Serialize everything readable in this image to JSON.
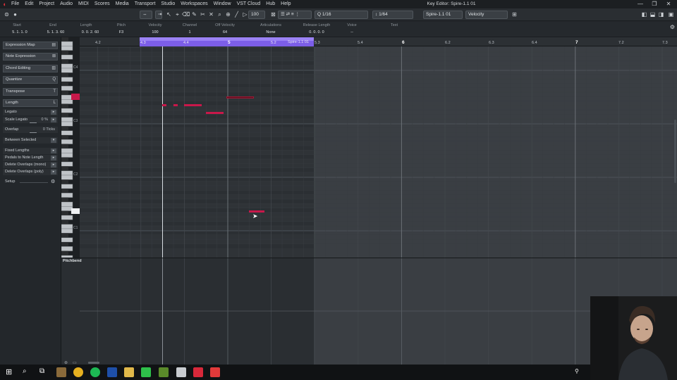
{
  "menubar": {
    "items": [
      "File",
      "Edit",
      "Project",
      "Audio",
      "MIDI",
      "Scores",
      "Media",
      "Transport",
      "Studio",
      "Workspaces",
      "Window",
      "VST Cloud",
      "Hub",
      "Help"
    ],
    "window_title": "Key Editor: Spire-1.1 01"
  },
  "toolbar": {
    "quantize_value": "1/16",
    "length_value": "1/64",
    "track_name": "Spire-1.1 01",
    "controller_lane": "Velocity",
    "velocity_value": "100"
  },
  "infoline": {
    "headers": [
      "Start",
      "End",
      "Length",
      "Pitch",
      "Velocity",
      "Channel",
      "Off Velocity",
      "Articulations",
      "Release Length",
      "Voice",
      "Text"
    ],
    "values": [
      "5. 1. 1.  0",
      "5. 1. 3. 60",
      "0. 0. 2. 60",
      "F3",
      "100",
      "1",
      "64",
      "None",
      "0. 0. 0.  0",
      "--",
      ""
    ]
  },
  "inspector": {
    "sections": [
      {
        "label": "Expression Map",
        "icon": "expression-map-icon"
      },
      {
        "label": "Note Expression",
        "icon": "note-expression-icon"
      },
      {
        "label": "Chord Editing",
        "icon": "chord-editing-icon"
      },
      {
        "label": "Quantize",
        "icon": "quantize-icon"
      },
      {
        "label": "Transpose",
        "icon": "transpose-icon"
      },
      {
        "label": "Length",
        "icon": "length-icon"
      }
    ],
    "length_items": {
      "legato": "Legato",
      "scale_legato": "Scale Legato",
      "scale_legato_value": "0 %",
      "overlap": "Overlap",
      "overlap_value": "0 Ticks",
      "between_selected": "Between Selected",
      "fixed_lengths": "Fixed Lengths",
      "pedals_to_note_length": "Pedals to Note Length",
      "delete_overlaps_mono": "Delete Overlaps (mono)",
      "delete_overlaps_poly": "Delete Overlaps (poly)",
      "setup": "Setup"
    }
  },
  "keyboard": {
    "labels": [
      "C4",
      "C3",
      "C2",
      "C1"
    ]
  },
  "ruler": {
    "labels": [
      "4.2",
      "4.3",
      "4.4",
      "5",
      "5.2",
      "5.3",
      "5.4",
      "6",
      "6.2",
      "6.3",
      "6.4",
      "7",
      "7.2",
      "7.3"
    ],
    "part_name": "Spire-1.1 01"
  },
  "controllane": {
    "label": "Pitchbend"
  },
  "colors": {
    "note": "#c8184a",
    "note_selected": "#5a0e1c",
    "ruler_range": "#8a6cf0",
    "part_region": "#2f3337",
    "outside_region": "#3a3e43"
  }
}
